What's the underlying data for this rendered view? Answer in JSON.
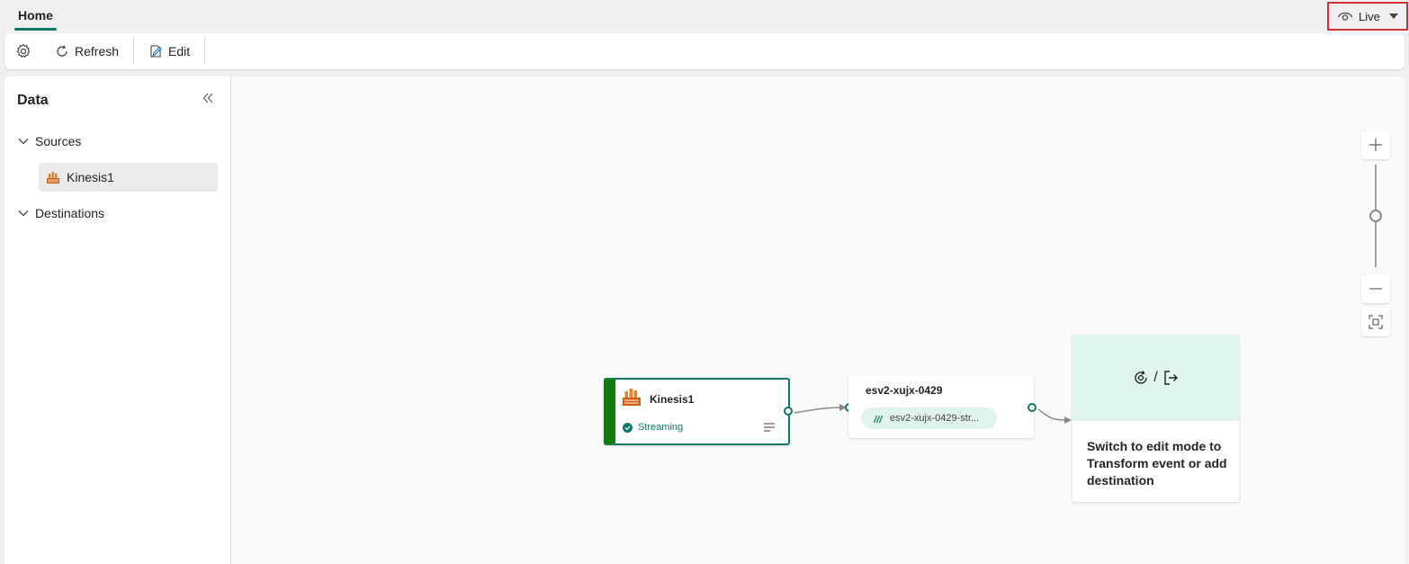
{
  "tabs": {
    "home": "Home"
  },
  "mode": {
    "label": "Live"
  },
  "toolbar": {
    "refresh": "Refresh",
    "edit": "Edit"
  },
  "sidebar": {
    "title": "Data",
    "sources_label": "Sources",
    "sources": [
      {
        "label": "Kinesis1"
      }
    ],
    "destinations_label": "Destinations"
  },
  "canvas": {
    "source_node": {
      "title": "Kinesis1",
      "status": "Streaming"
    },
    "stream_node": {
      "title": "esv2-xujx-0429",
      "chip": "esv2-xujx-0429-str..."
    },
    "dest_node": {
      "separator": "/",
      "message": "Switch to edit mode to Transform event or add destination"
    },
    "zoom_level": 0.5
  },
  "colors": {
    "accent": "#117865",
    "streaming_bar": "#107c10",
    "highlight_border": "#d13438",
    "card_green": "#e0f5ee"
  }
}
